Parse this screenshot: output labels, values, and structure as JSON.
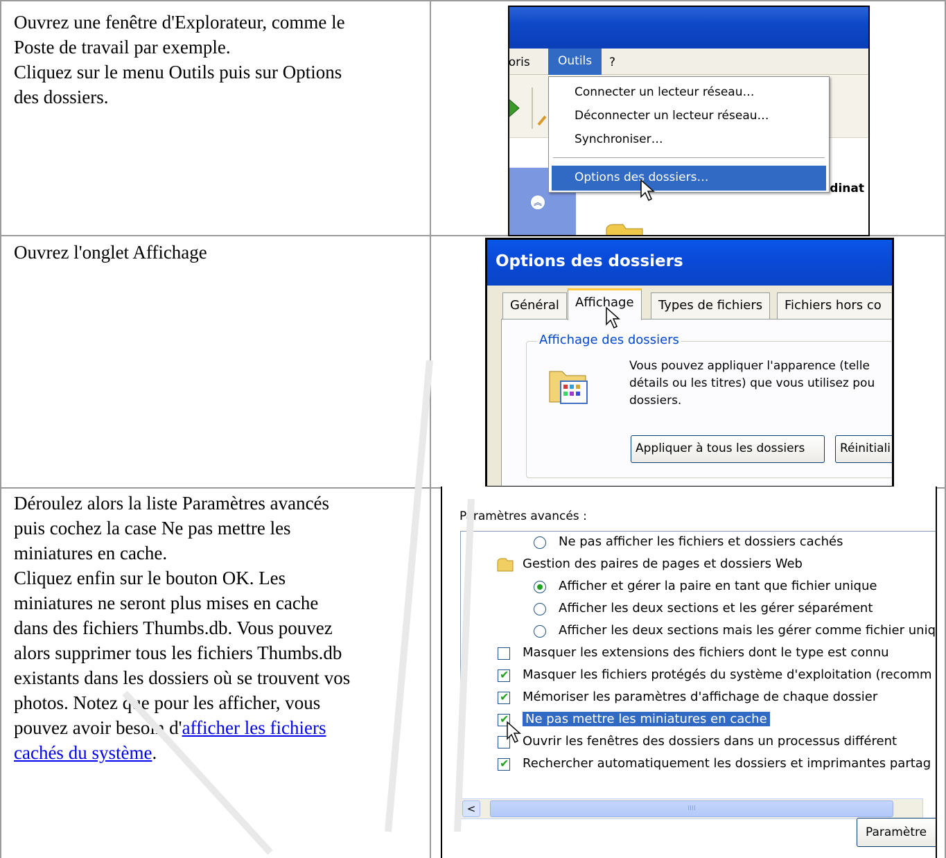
{
  "rows": [
    {
      "lines": [
        "Ouvrez une fenêtre d'Explorateur, comme le",
        "Poste de travail par exemple.",
        "Cliquez sur le menu Outils puis sur Options",
        "des dossiers."
      ]
    },
    {
      "lines": [
        "Ouvrez l'onglet Affichage"
      ]
    },
    {
      "lines": [
        "Déroulez alors la liste Paramètres avancés",
        "puis cochez la case Ne pas mettre les",
        "miniatures en cache.",
        "Cliquez enfin sur le bouton OK. Les",
        "miniatures ne seront plus mises en cache",
        "dans des fichiers Thumbs.db. Vous pouvez",
        "alors supprimer tous les fichiers Thumbs.db",
        "existants dans les dossiers où se trouvent vos",
        "photos. Notez que pour les afficher, vous"
      ],
      "line_before_link": "pouvez avoir besoin d'",
      "link_line1": "afficher les fichiers",
      "link_line2": "cachés du système",
      "after_link": "."
    }
  ],
  "shot1": {
    "menu_left_partial": "ioris",
    "menu_outils": "Outils",
    "menu_help": "?",
    "items": [
      "Connecter un lecteur réseau…",
      "Déconnecter un lecteur réseau…",
      "Synchroniser…"
    ],
    "highlighted": "Options des dossiers…",
    "right_partial": "dinat"
  },
  "shot2": {
    "title": "Options des dossiers",
    "tabs": [
      "Général",
      "Affichage",
      "Types de fichiers",
      "Fichiers hors co"
    ],
    "group_legend": "Affichage des dossiers",
    "paragraph": "Vous pouvez appliquer l'apparence (telle\ndétails ou les titres) que vous utilisez pou\ndossiers.",
    "button_apply": "Appliquer à tous les dossiers",
    "button_reset": "Réinitiali"
  },
  "shot3": {
    "header": "Paramètres avancés :",
    "rows": [
      {
        "kind": "radio",
        "checked": false,
        "indent": 1,
        "text": "Ne pas afficher les fichiers et dossiers cachés"
      },
      {
        "kind": "folder",
        "checked": false,
        "indent": 0,
        "text": "Gestion des paires de pages et dossiers Web"
      },
      {
        "kind": "radio",
        "checked": true,
        "indent": 1,
        "text": "Afficher et gérer la paire en tant que fichier unique"
      },
      {
        "kind": "radio",
        "checked": false,
        "indent": 1,
        "text": "Afficher les deux sections et les gérer séparément"
      },
      {
        "kind": "radio",
        "checked": false,
        "indent": 1,
        "text": "Afficher les deux sections mais les gérer comme fichier uniq"
      },
      {
        "kind": "checkbox",
        "checked": false,
        "indent": 0,
        "text": "Masquer les extensions des fichiers dont le type est connu"
      },
      {
        "kind": "checkbox",
        "checked": true,
        "indent": 0,
        "text": "Masquer les fichiers protégés du système d'exploitation (recomm"
      },
      {
        "kind": "checkbox",
        "checked": true,
        "indent": 0,
        "text": "Mémoriser les paramètres d'affichage de chaque dossier"
      },
      {
        "kind": "checkbox",
        "checked": true,
        "indent": 0,
        "text": "Ne pas mettre les miniatures en cache",
        "selected": true
      },
      {
        "kind": "checkbox",
        "checked": false,
        "indent": 0,
        "text": "Ouvrir les fenêtres des dossiers dans un processus différent"
      },
      {
        "kind": "checkbox",
        "checked": true,
        "indent": 0,
        "text": "Rechercher automatiquement les dossiers et imprimantes partag"
      }
    ],
    "scroll_grip": "IIII",
    "button_params": "Paramètre"
  },
  "colors": {
    "xp_blue": "#316ac5",
    "title_blue": "#0a48d6",
    "link": "#0000ee",
    "check_green": "#21a121"
  }
}
